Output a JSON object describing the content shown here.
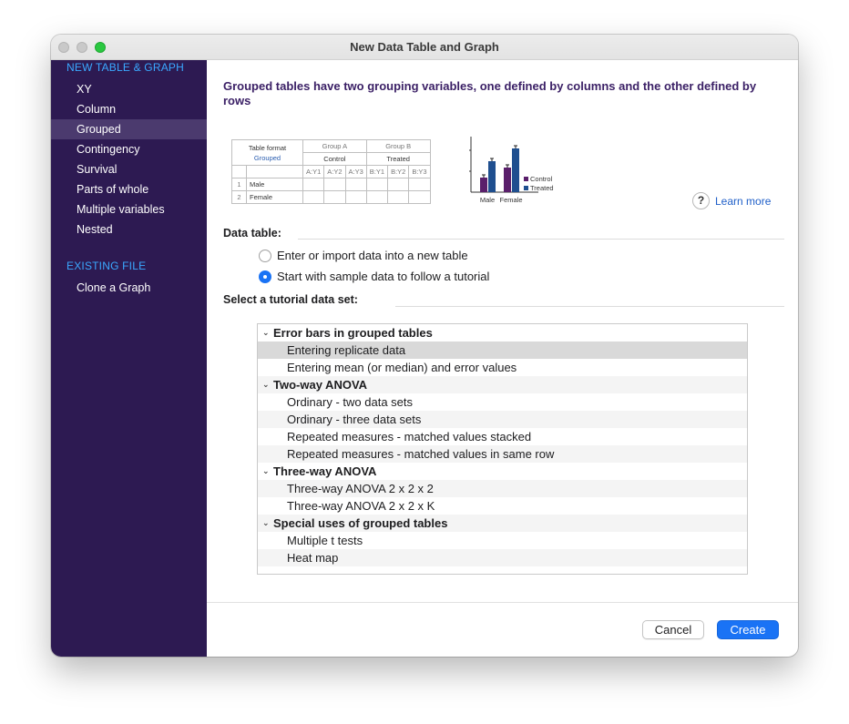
{
  "window": {
    "title": "New Data Table and Graph"
  },
  "sidebar": {
    "new_header": "NEW TABLE & GRAPH",
    "new_items": [
      "XY",
      "Column",
      "Grouped",
      "Contingency",
      "Survival",
      "Parts of whole",
      "Multiple variables",
      "Nested"
    ],
    "selected": "Grouped",
    "existing_header": "EXISTING FILE",
    "existing_items": [
      "Clone a Graph"
    ]
  },
  "content": {
    "headline": "Grouped tables have two grouping variables, one defined by columns and the other defined by rows",
    "preview_table": {
      "format_label": "Table format",
      "format_value": "Grouped",
      "group_a": "Group A",
      "group_b": "Group B",
      "group_a_name": "Control",
      "group_b_name": "Treated",
      "columns": [
        "A:Y1",
        "A:Y2",
        "A:Y3",
        "B:Y1",
        "B:Y2",
        "B:Y3"
      ],
      "row_numbers": [
        "1",
        "2"
      ],
      "row_labels": [
        "Male",
        "Female"
      ]
    },
    "preview_chart": {
      "categories": [
        "Male",
        "Female"
      ],
      "legend": [
        "Control",
        "Treated"
      ],
      "colors": {
        "control": "#5a1f6b",
        "treated": "#1f4f8f"
      }
    },
    "learn_more": {
      "icon": "?",
      "label": "Learn more"
    },
    "data_table": {
      "label": "Data table:",
      "options": [
        "Enter or import data into a new table",
        "Start with sample data to follow a tutorial"
      ],
      "selected_index": 1
    },
    "tutorial": {
      "label": "Select a tutorial data set:",
      "groups": [
        {
          "title": "Error bars in grouped tables",
          "items": [
            "Entering replicate data",
            "Entering mean (or median) and error values"
          ]
        },
        {
          "title": "Two-way ANOVA",
          "items": [
            "Ordinary - two data sets",
            "Ordinary - three data sets",
            "Repeated measures - matched values stacked",
            "Repeated measures - matched values in same row"
          ]
        },
        {
          "title": "Three-way ANOVA",
          "items": [
            "Three-way ANOVA 2 x 2 x 2",
            "Three-way ANOVA 2 x 2 x K"
          ]
        },
        {
          "title": "Special uses of grouped tables",
          "items": [
            "Multiple t tests",
            "Heat map"
          ]
        }
      ],
      "selected_item": "Entering replicate data"
    }
  },
  "buttons": {
    "cancel": "Cancel",
    "create": "Create"
  },
  "colors": {
    "sidebar_bg": "#2d1a52",
    "sidebar_header": "#3aa8ff",
    "accent": "#1a73f5",
    "headline": "#3a1f65"
  }
}
